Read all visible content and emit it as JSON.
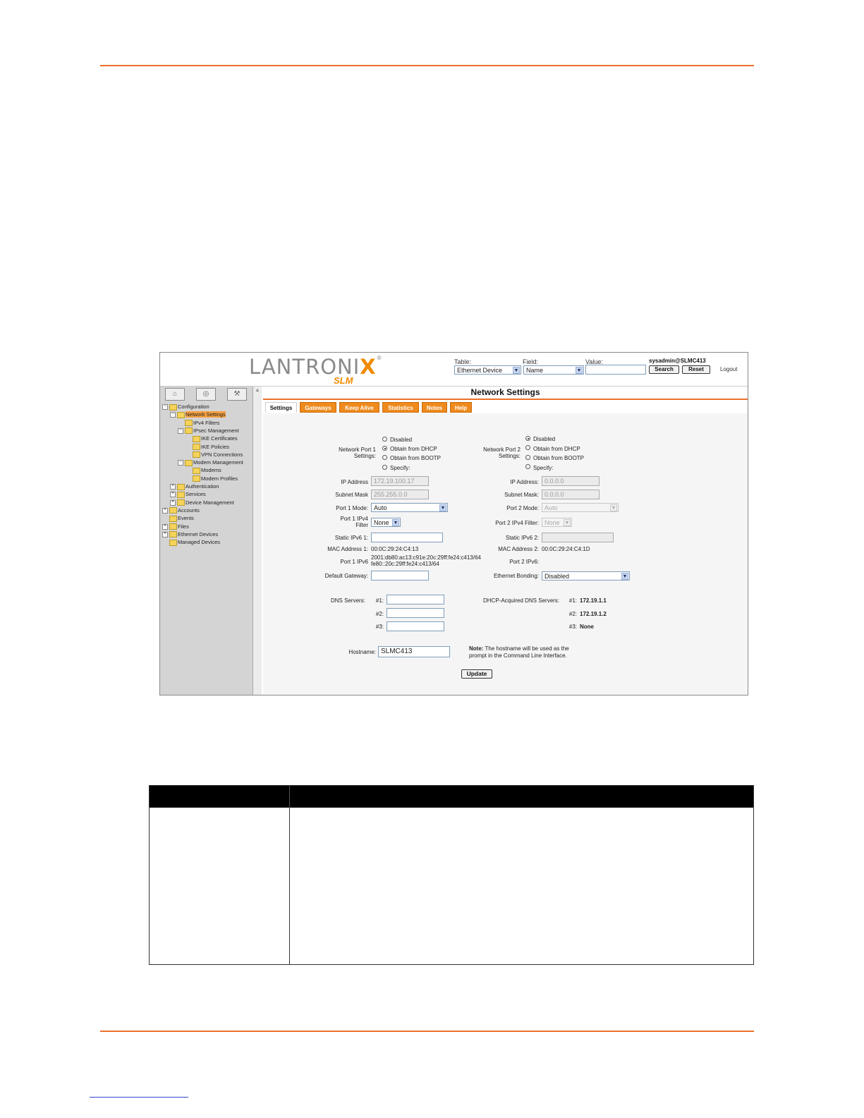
{
  "app": {
    "brand": "LANTRONIX",
    "brand_mark": "®",
    "product": "SLM",
    "user": "sysadmin@SLMC413",
    "logout_label": "Logout"
  },
  "search": {
    "table_label": "Table:",
    "table_value": "Ethernet Device",
    "field_label": "Field:",
    "field_value": "Name",
    "value_label": "Value:",
    "value_value": "",
    "search_button": "Search",
    "reset_button": "Reset"
  },
  "nav": {
    "icons": [
      "home-icon",
      "refresh-icon",
      "tools-icon"
    ],
    "tree": [
      {
        "label": "Configuration",
        "level": 0,
        "toggle": "−"
      },
      {
        "label": "Network Settings",
        "level": 1,
        "toggle": "−",
        "selected": true
      },
      {
        "label": "IPv4 Filters",
        "level": 2,
        "toggle": ""
      },
      {
        "label": "IPsec Management",
        "level": 2,
        "toggle": "−"
      },
      {
        "label": "IKE Certificates",
        "level": 3,
        "toggle": ""
      },
      {
        "label": "IKE Policies",
        "level": 3,
        "toggle": ""
      },
      {
        "label": "VPN Connections",
        "level": 3,
        "toggle": ""
      },
      {
        "label": "Modem Management",
        "level": 2,
        "toggle": "−"
      },
      {
        "label": "Modems",
        "level": 3,
        "toggle": ""
      },
      {
        "label": "Modem Profiles",
        "level": 3,
        "toggle": ""
      },
      {
        "label": "Authentication",
        "level": 1,
        "toggle": "+"
      },
      {
        "label": "Services",
        "level": 1,
        "toggle": "+"
      },
      {
        "label": "Device Management",
        "level": 1,
        "toggle": "+"
      },
      {
        "label": "Accounts",
        "level": 0,
        "toggle": "+"
      },
      {
        "label": "Events",
        "level": 0,
        "toggle": ""
      },
      {
        "label": "Files",
        "level": 0,
        "toggle": "+"
      },
      {
        "label": "Ethernet Devices",
        "level": 0,
        "toggle": "+"
      },
      {
        "label": "Managed Devices",
        "level": 0,
        "toggle": ""
      }
    ]
  },
  "page": {
    "title": "Network Settings",
    "tabs": [
      "Settings",
      "Gateways",
      "Keep Alive",
      "Statistics",
      "Notes",
      "Help"
    ],
    "active_tab": "Settings"
  },
  "form": {
    "port1": {
      "settings_label": "Network Port 1 Settings:",
      "options": [
        "Disabled",
        "Obtain from DHCP",
        "Obtain from BOOTP",
        "Specify:"
      ],
      "selected": "Obtain from DHCP",
      "ip_label": "IP Address",
      "ip_value": "172.19.100.17",
      "mask_label": "Subnet Mask",
      "mask_value": "255.255.0.0",
      "mode_label": "Port 1 Mode:",
      "mode_value": "Auto",
      "filter_label": "Port 1 IPv4 Filter",
      "filter_value": "None",
      "static_ipv6_label": "Static IPv6 1:",
      "static_ipv6_value": "",
      "mac_label": "MAC Address 1:",
      "mac_value": "00:0C:29:24:C4:13",
      "ipv6_label": "Port 1 IPv6",
      "ipv6_line1": "2001:db80:ac13:c91e:20c:29ff:fe24:c413/64",
      "ipv6_line2": "fe80::20c:29ff:fe24:c413/64"
    },
    "port2": {
      "settings_label": "Network Port 2 Settings:",
      "options": [
        "Disabled",
        "Obtain from DHCP",
        "Obtain from BOOTP",
        "Specify:"
      ],
      "selected": "Disabled",
      "ip_label": "IP Address:",
      "ip_value": "0.0.0.0",
      "mask_label": "Subnet Mask:",
      "mask_value": "0.0.0.0",
      "mode_label": "Port 2 Mode:",
      "mode_value": "Auto",
      "filter_label": "Port 2 IPv4 Filter:",
      "filter_value": "None",
      "static_ipv6_label": "Static IPv6 2:",
      "static_ipv6_value": "",
      "mac_label": "MAC Address 2:",
      "mac_value": "00:0C:29:24:C4:1D",
      "ipv6_label": "Port 2 IPv6:"
    },
    "default_gateway_label": "Default Gateway:",
    "default_gateway_value": "",
    "bonding_label": "Ethernet Bonding:",
    "bonding_value": "Disabled",
    "dns_label": "DNS Servers:",
    "dns": [
      {
        "label": "#1:",
        "value": ""
      },
      {
        "label": "#2:",
        "value": ""
      },
      {
        "label": "#3:",
        "value": ""
      }
    ],
    "dhcp_dns_label": "DHCP-Acquired DNS Servers:",
    "dhcp_dns": [
      {
        "label": "#1:",
        "value": "172.19.1.1"
      },
      {
        "label": "#2:",
        "value": "172.19.1.2"
      },
      {
        "label": "#3:",
        "value": "None"
      }
    ],
    "hostname_label": "Hostname:",
    "hostname_value": "SLMC413",
    "note_bold": "Note:",
    "note_line1": "The hostname will be used as the",
    "note_line2": "prompt in the Command Line Interface.",
    "update_button": "Update"
  }
}
